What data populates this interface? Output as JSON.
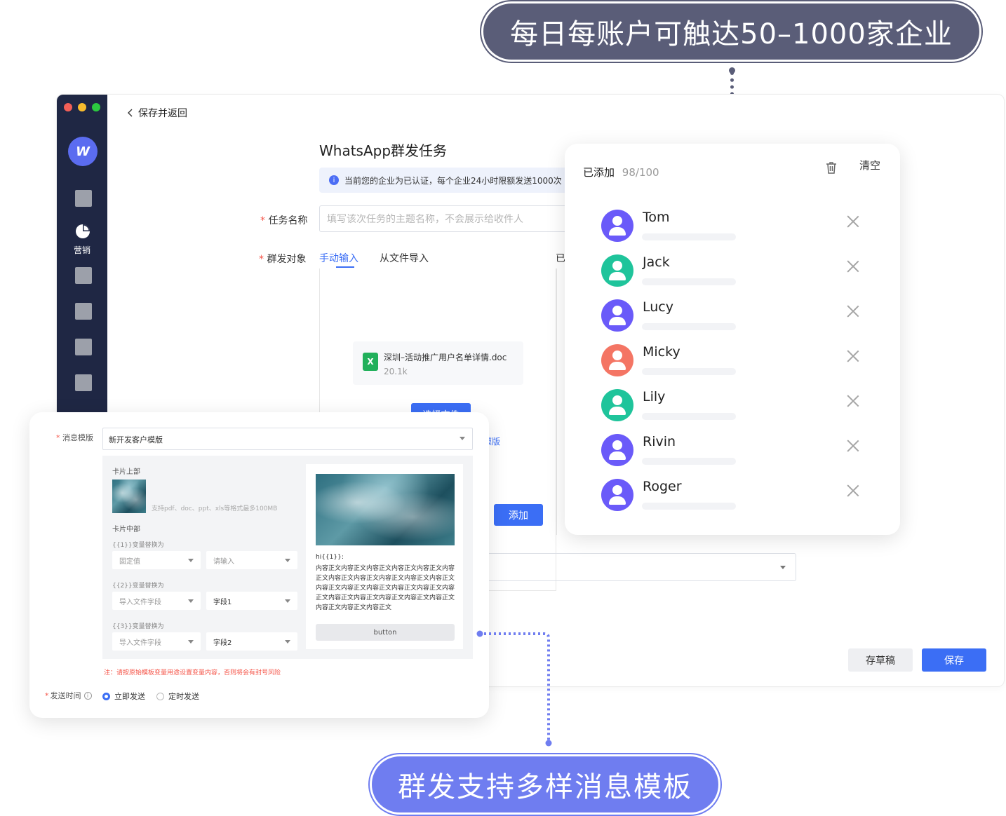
{
  "callouts": {
    "top": "每日每账户可触达50–1000家企业",
    "bottom": "群发支持多样消息模板"
  },
  "sidebar": {
    "active_label": "营销",
    "logo_text": "W"
  },
  "header": {
    "back_label": "保存并返回",
    "page_title": "WhatsApp群发任务"
  },
  "alert": {
    "icon": "i",
    "text": "当前您的企业为已认证，每个企业24小时限额发送1000次"
  },
  "form": {
    "task_name_label": "任务名称",
    "task_name_placeholder": "填写该次任务的主题名称，不会展示给收件人",
    "target_label": "群发对象",
    "tabs": [
      "手动输入",
      "从文件导入"
    ],
    "right_cut_label": "已",
    "file": {
      "name": "深圳–活动推广用户名单详情.doc",
      "size": "20.1k",
      "icon_text": "X"
    },
    "select_file_button": "选择文件",
    "template_link_fragment": "模版",
    "add_button": "添加",
    "draft_button": "存草稿",
    "save_button": "保存"
  },
  "added_panel": {
    "label": "已添加",
    "count": "98/100",
    "clear_label": "清空",
    "contacts": [
      {
        "name": "Tom",
        "color": "#6a5af9"
      },
      {
        "name": "Jack",
        "color": "#1fc49b"
      },
      {
        "name": "Lucy",
        "color": "#6a5af9"
      },
      {
        "name": "Micky",
        "color": "#f47564"
      },
      {
        "name": "Lily",
        "color": "#1fc49b"
      },
      {
        "name": "Rivin",
        "color": "#6a5af9"
      },
      {
        "name": "Roger",
        "color": "#6a5af9"
      }
    ]
  },
  "template_card": {
    "template_label": "消息模版",
    "template_value": "新开发客户模版",
    "card_top_label": "卡片上部",
    "upload_hint": "支持pdf、doc、ppt、xls等格式最多100MB",
    "card_mid_label": "卡片中部",
    "vars": [
      {
        "label": "{{1}}变量替换为",
        "left": "固定值",
        "right": "请输入"
      },
      {
        "label": "{{2}}变量替换为",
        "left": "导入文件字段",
        "right": "字段1"
      },
      {
        "label": "{{3}}变量替换为",
        "left": "导入文件字段",
        "right": "字段2"
      }
    ],
    "preview_greeting": "hi{{1}}:",
    "preview_body": "内容正文内容正文内容正文内容正文内容正文内容正文内容正文内容正文内容正文内容正文内容正文内容正文内容正文内容正文内容正文内容正文内容正文内容正文内容正文内容正文内容正文内容正文内容正文内容正文内容正文",
    "preview_button": "button",
    "note": "注：请按原始模板变量用途设置变量内容，否则将会有封号风险",
    "send_time_label": "发送时间",
    "send_now": "立即发送",
    "send_scheduled": "定时发送"
  },
  "colors": {
    "accent": "#3b6ef5",
    "sidebar_bg": "#1f2744",
    "top_pill": "#5a5d78",
    "bottom_pill": "#6f7df0"
  }
}
